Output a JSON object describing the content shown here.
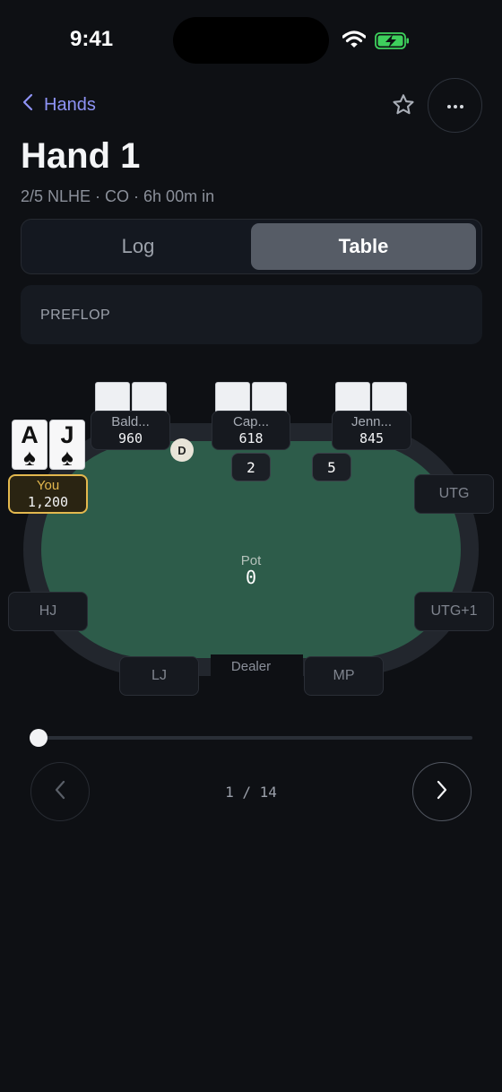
{
  "status_bar": {
    "time": "9:41",
    "icons": [
      "wifi-icon",
      "battery-charging-icon"
    ]
  },
  "nav": {
    "back_label": "Hands",
    "icons": [
      "chevron-left-icon",
      "star-icon",
      "more-icon"
    ]
  },
  "hand": {
    "title": "Hand 1",
    "subtitle": "2/5 NLHE · CO · 6h 00m in"
  },
  "segmented": {
    "options": [
      "Log",
      "Table"
    ],
    "selected": "Table"
  },
  "street": {
    "label": "PREFLOP"
  },
  "table": {
    "players": [
      {
        "name": "Bald...",
        "stack": "960"
      },
      {
        "name": "Cap...",
        "stack": "618"
      },
      {
        "name": "Jenn...",
        "stack": "845"
      }
    ],
    "hero": {
      "name": "You",
      "stack": "1,200",
      "cards": [
        {
          "rank": "A",
          "suit": "♠"
        },
        {
          "rank": "J",
          "suit": "♠"
        }
      ]
    },
    "bets": [
      "2",
      "5"
    ],
    "dealer_button": "D",
    "empty_seats": {
      "utg": "UTG",
      "utg1": "UTG+1",
      "hj": "HJ",
      "lj": "LJ",
      "mp": "MP"
    },
    "pot_label": "Pot",
    "pot_value": "0",
    "dealer_label": "Dealer",
    "colors": {
      "felt": "#2d5c4a",
      "hero_accent": "#e3b84e",
      "link": "#8e93f5"
    }
  },
  "player_nav": {
    "counter": "1 / 14",
    "progress_fraction": 0,
    "icons": [
      "chevron-left-icon",
      "chevron-right-icon"
    ]
  }
}
